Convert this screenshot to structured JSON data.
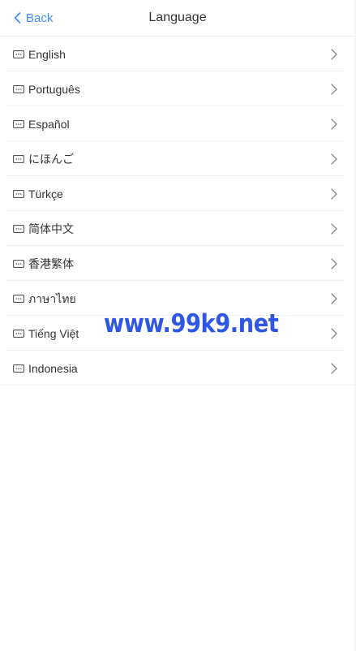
{
  "header": {
    "back_label": "Back",
    "title": "Language",
    "accent_color": "#3f8cff"
  },
  "languages": [
    {
      "label": "English"
    },
    {
      "label": "Português"
    },
    {
      "label": "Español"
    },
    {
      "label": "にほんご"
    },
    {
      "label": "Türkçe"
    },
    {
      "label": "简体中文"
    },
    {
      "label": "香港繁体"
    },
    {
      "label": "ภาษาไทย"
    },
    {
      "label": "Tiếng Việt"
    },
    {
      "label": "Indonesia"
    }
  ],
  "icons": {
    "row_icon": "language-icon",
    "row_arrow": "chevron-right-icon",
    "back": "chevron-left-icon"
  },
  "watermark": {
    "text": "www.99k9.net",
    "color": "#2f57e6"
  }
}
